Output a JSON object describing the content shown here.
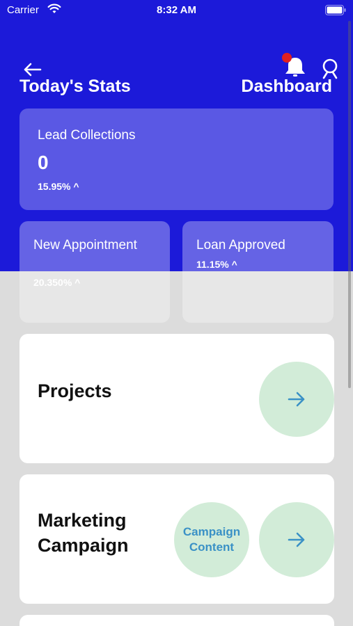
{
  "status_bar": {
    "carrier": "Carrier",
    "time": "8:32 AM"
  },
  "header": {
    "title": "Today's Stats",
    "right_title": "Dashboard"
  },
  "stats": {
    "lead": {
      "label": "Lead Collections",
      "value": "0",
      "percent": "15.95%  ^"
    },
    "appointment": {
      "label": "New Appointment",
      "percent": "20.350%  ^"
    },
    "loan": {
      "label": "Loan Approved",
      "percent": "11.15%  ^"
    }
  },
  "cards": {
    "projects": {
      "title": "Projects"
    },
    "marketing": {
      "title": "Marketing Campaign",
      "content_button": "Campaign Content"
    }
  },
  "colors": {
    "primary": "#1c1ad9",
    "card_light": "#5a58e4",
    "circle": "#d2ecd8",
    "accent": "#3a91c6",
    "notification_dot": "#e02020"
  },
  "icons": [
    "wifi-icon",
    "battery-icon",
    "back-arrow-icon",
    "bell-icon",
    "user-icon",
    "arrow-right-icon"
  ]
}
